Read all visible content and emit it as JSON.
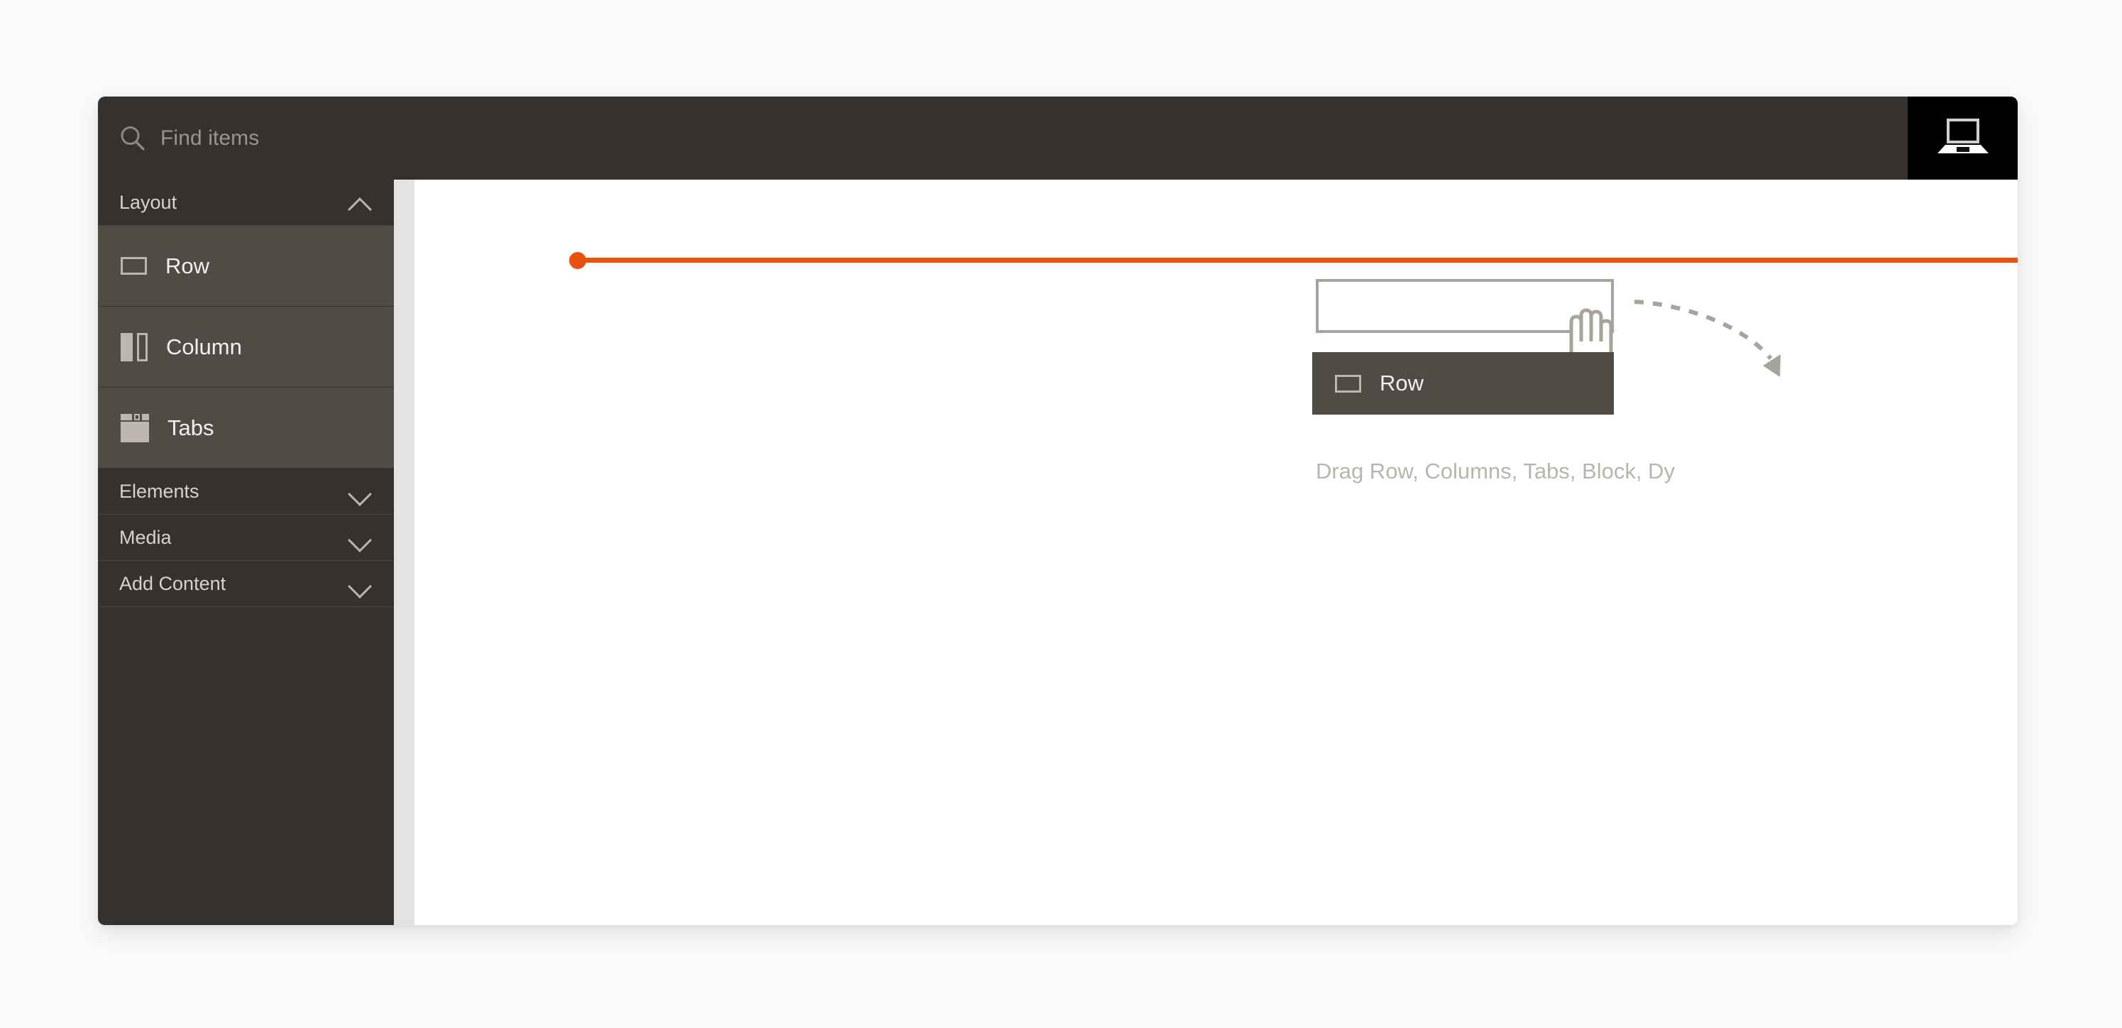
{
  "window": {
    "name": "page-builder-window"
  },
  "topbar": {
    "search": {
      "placeholder": "Find items",
      "value": "",
      "icon": "search-icon"
    },
    "device_toggle": {
      "icon": "desktop-laptop-icon",
      "label": "Desktop"
    }
  },
  "sidebar": {
    "sections": [
      {
        "label": "Layout",
        "expanded": true,
        "chevron": "chevron-up-icon",
        "items": [
          {
            "label": "Row",
            "icon": "row-icon"
          },
          {
            "label": "Column",
            "icon": "column-icon"
          },
          {
            "label": "Tabs",
            "icon": "tabs-icon"
          }
        ]
      },
      {
        "label": "Elements",
        "expanded": false,
        "chevron": "chevron-down-icon",
        "items": []
      },
      {
        "label": "Media",
        "expanded": false,
        "chevron": "chevron-down-icon",
        "items": []
      },
      {
        "label": "Add Content",
        "expanded": false,
        "chevron": "chevron-down-icon",
        "items": []
      }
    ]
  },
  "canvas": {
    "drop_indicator": {
      "color": "#e8520d",
      "name": "drop-position-line"
    },
    "drag_ghost": {
      "label": "Row",
      "icon": "row-icon"
    },
    "drop_hint": {
      "text": "Drag Row, Columns, Tabs, Block, Dy",
      "text_truncated": true,
      "hand_icon": "hand-drag-icon",
      "arrow_icon": "curved-dashed-arrow-icon",
      "box_name": "drop-target-outline"
    }
  },
  "colors": {
    "page_background": "#fafafa",
    "chrome_dark": "#35312e",
    "item_background": "#514b46",
    "accent_orange": "#e8520d",
    "hint_gray": "#a8a49c",
    "canvas_white": "#ffffff"
  }
}
